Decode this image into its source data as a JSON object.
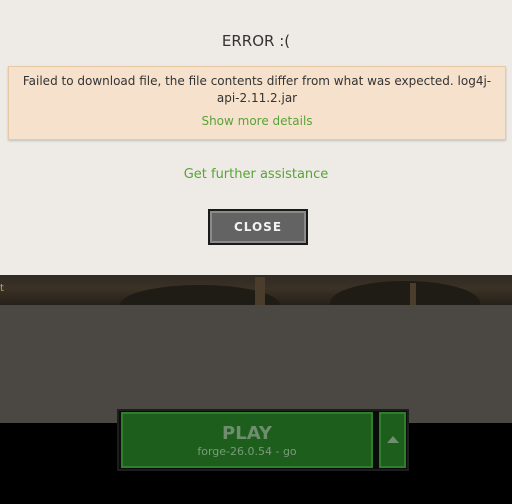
{
  "dialog": {
    "title": "ERROR :(",
    "message": "Failed to download file, the file contents differ from what was expected. log4j-api-2.11.2.jar",
    "details_link": "Show more details",
    "assist_link": "Get further assistance",
    "close_label": "CLOSE"
  },
  "launcher": {
    "play_label": "PLAY",
    "version_label": "forge-26.0.54  -   go",
    "arrow_icon": "chevron-up-icon"
  },
  "colors": {
    "dialog_bg": "#eeebe6",
    "error_bg": "#f6e2cc",
    "link_green": "#5aa23a",
    "play_green": "#1d5e1d",
    "close_gray": "#636363"
  }
}
